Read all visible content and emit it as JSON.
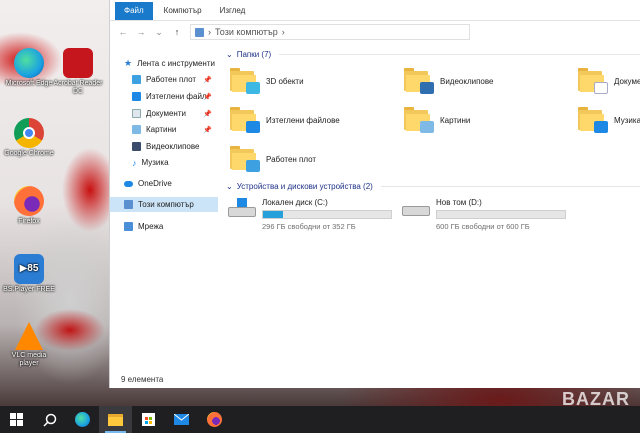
{
  "desktop": {
    "icons": [
      {
        "label": "Microsoft Edge",
        "color": "#1ba1e2"
      },
      {
        "label": "Acrobat Reader DC",
        "color": "#c4161c"
      },
      {
        "label": "Google Chrome",
        "color": "#e8e8e8"
      },
      {
        "label": "Firefox",
        "color": "#ff7139"
      },
      {
        "label": "BS.Player FREE",
        "color": "#2b7cd3"
      },
      {
        "label": "VLC media player",
        "color": "#ff8800"
      }
    ]
  },
  "ribbon": {
    "tabs": [
      "Файл",
      "Компютър",
      "Изглед"
    ]
  },
  "address": {
    "back": "←",
    "forward": "→",
    "dropdown": "⌄",
    "up": "↑",
    "path": "Този компютър",
    "chevron": "›"
  },
  "sidebar": {
    "quick_access": "Лента с инструменти",
    "items": [
      {
        "label": "Работен плот",
        "pinned": true
      },
      {
        "label": "Изтеглени файл",
        "pinned": true
      },
      {
        "label": "Документи",
        "pinned": true
      },
      {
        "label": "Картини",
        "pinned": true
      },
      {
        "label": "Видеоклипове",
        "pinned": false
      },
      {
        "label": "Музика",
        "pinned": false
      }
    ],
    "onedrive": "OneDrive",
    "this_pc": "Този компютър",
    "network": "Мрежа",
    "pin_glyph": "📌"
  },
  "content": {
    "folders_header": "Папки (7)",
    "folders": [
      {
        "label": "3D обекти",
        "badge": "#3db7e4"
      },
      {
        "label": "Видеоклипове",
        "badge": "#2f6fb0"
      },
      {
        "label": "Документи",
        "badge": "#ffffff"
      },
      {
        "label": "Изтеглени файлове",
        "badge": "#1e88e5"
      },
      {
        "label": "Картини",
        "badge": "#7fb9e6"
      },
      {
        "label": "Музика",
        "badge": "#1e88e5"
      },
      {
        "label": "Работен плот",
        "badge": "#3da0e0"
      }
    ],
    "drives_header": "Устройства и дискови устройства (2)",
    "drives": [
      {
        "name": "Локален диск (C:)",
        "free": "296 ГБ свободни от 352 ГБ",
        "used_fraction": 0.16
      },
      {
        "name": "Нов том (D:)",
        "free": "600 ГБ свободни от 600 ГБ",
        "used_fraction": 0.0
      }
    ],
    "chevron": "⌄"
  },
  "status": {
    "text": "9 елемента"
  },
  "taskbar": {
    "items": [
      "start",
      "search",
      "edge",
      "file-explorer",
      "store",
      "mail",
      "firefox"
    ]
  },
  "watermark": "BAZAR"
}
